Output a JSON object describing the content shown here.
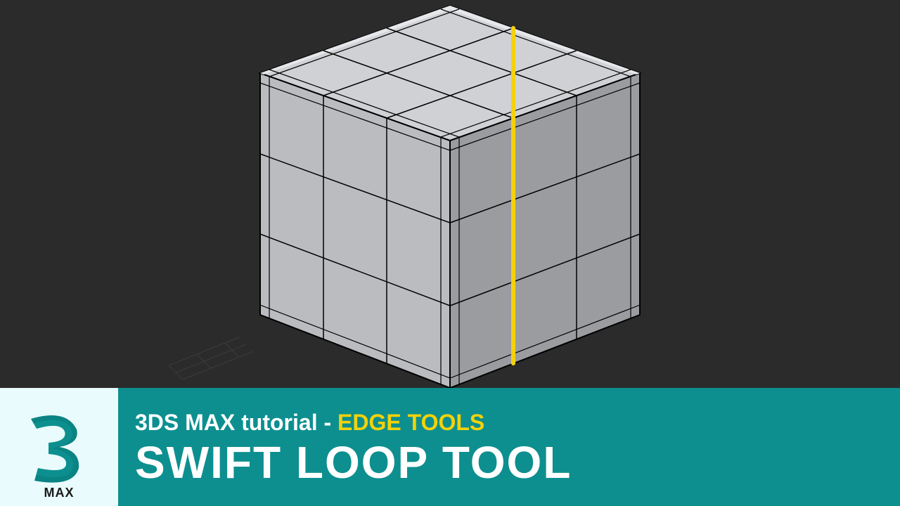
{
  "banner": {
    "logo_label": "MAX",
    "line1_left": "3DS MAX tutorial - ",
    "line1_accent": "EDGE TOOLS",
    "line2": "SWIFT LOOP TOOL"
  },
  "colors": {
    "teal": "#0d8f8f",
    "bg": "#2b2b2b",
    "highlight": "#f3d20a",
    "glow": "#35f0d0",
    "cube_light": "#d0d1d4",
    "cube_mid": "#babcc0",
    "cube_dark": "#9a9ca0",
    "edge": "#000000"
  }
}
